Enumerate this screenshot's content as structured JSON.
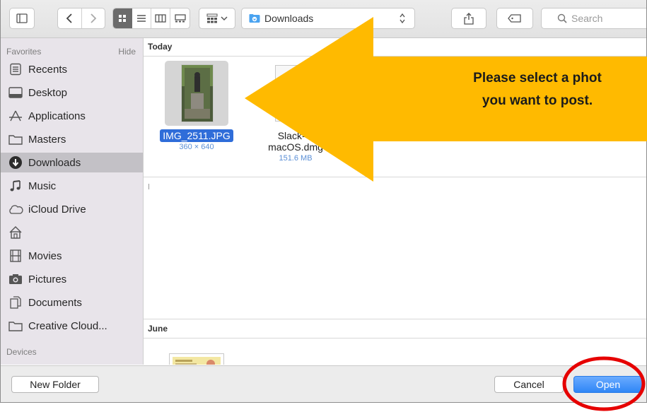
{
  "toolbar": {
    "path_label": "Downloads",
    "search_placeholder": "Search"
  },
  "sidebar": {
    "favorites_header": "Favorites",
    "hide_label": "Hide",
    "devices_header": "Devices",
    "items": [
      {
        "label": "Recents",
        "icon": "recents-icon"
      },
      {
        "label": "Desktop",
        "icon": "desktop-icon"
      },
      {
        "label": "Applications",
        "icon": "applications-icon"
      },
      {
        "label": "Masters",
        "icon": "folder-icon"
      },
      {
        "label": "Downloads",
        "icon": "downloads-icon",
        "selected": true
      },
      {
        "label": "Music",
        "icon": "music-icon"
      },
      {
        "label": "iCloud Drive",
        "icon": "cloud-icon"
      },
      {
        "label": "",
        "icon": "home-icon"
      },
      {
        "label": "Movies",
        "icon": "movies-icon"
      },
      {
        "label": "Pictures",
        "icon": "camera-icon"
      },
      {
        "label": "Documents",
        "icon": "documents-icon"
      },
      {
        "label": "Creative Cloud...",
        "icon": "folder-icon"
      }
    ]
  },
  "main": {
    "sections": [
      {
        "title": "Today"
      },
      {
        "title": "June"
      }
    ],
    "files": [
      {
        "name": "IMG_2511.JPG",
        "meta": "360 × 640",
        "selected": true
      },
      {
        "name_line1": "Slack-4.",
        "name_line2": "macOS.dmg",
        "meta": "151.6 MB"
      }
    ]
  },
  "callout": {
    "line1": "Please select a phot",
    "line2": "you want to post."
  },
  "buttons": {
    "new_folder": "New Folder",
    "cancel": "Cancel",
    "open": "Open"
  },
  "colors": {
    "accent": "#2f86f6",
    "arrow": "#ffba00",
    "ring": "#e60000"
  }
}
